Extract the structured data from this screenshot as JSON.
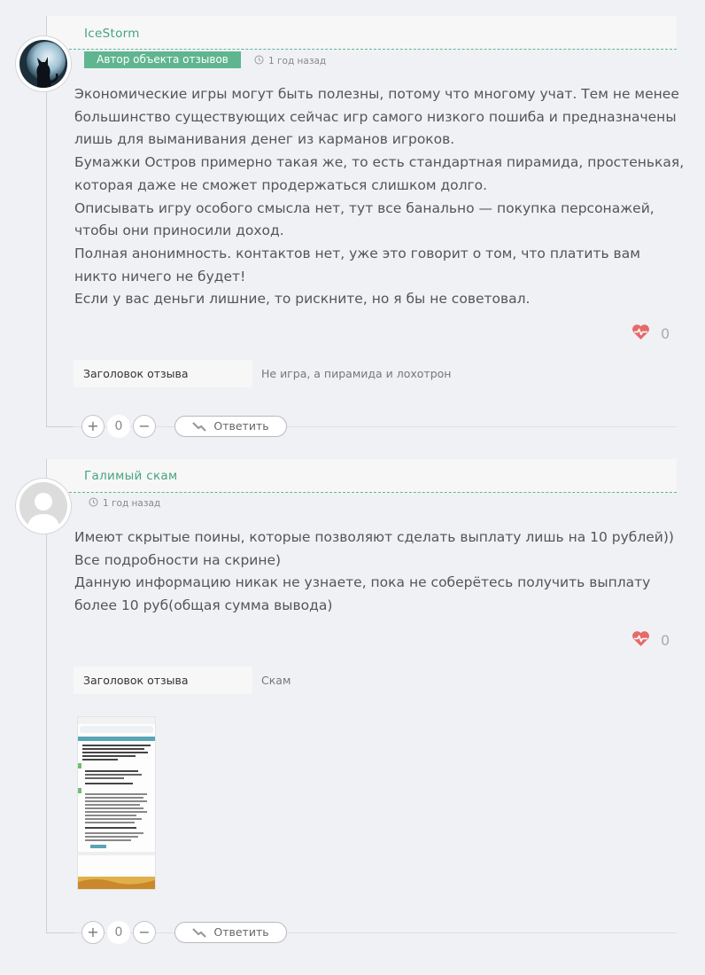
{
  "comments": [
    {
      "author": "IceStorm",
      "badge": "Автор объекта отзывов",
      "time": "1 год назад",
      "paragraphs": [
        "Экономические игры могут быть полезны, потому что многому учат. Тем не менее большинство существующих сейчас игр самого низкого пошиба и предназначены лишь для выманивания денег из карманов игроков.",
        "Бумажки Остров примерно такая же, то есть стандартная пирамида, простенькая, которая даже не сможет продержаться слишком долго.",
        "Описывать игру особого смысла нет, тут все банально — покупка персонажей, чтобы они приносили доход.",
        "Полная анонимность. контактов нет, уже это говорит о том, что платить вам никто ничего не будет!",
        "Если у вас деньги лишние, то рискните, но я бы не советовал."
      ],
      "likes": "0",
      "review_title_label": "Заголовок отзыва",
      "review_title_value": "Не игра, а пирамида и лохотрон",
      "vote_plus": "+",
      "vote_count": "0",
      "vote_minus": "−",
      "reply_label": "Ответить"
    },
    {
      "author": "Галимый скам",
      "time": "1 год назад",
      "paragraphs": [
        "Имеют скрытые поины, которые позволяют сделать выплату лишь на 10 рублей))",
        "Все подробности на скрине)",
        "Данную информацию никак не узнаете, пока не соберётесь получить выплату более 10 руб(общая сумма вывода)"
      ],
      "likes": "0",
      "review_title_label": "Заголовок отзыва",
      "review_title_value": "Скам",
      "vote_plus": "+",
      "vote_count": "0",
      "vote_minus": "−",
      "reply_label": "Ответить"
    }
  ],
  "colors": {
    "accent": "#5fb58f",
    "author": "#45a37e",
    "heart": "#e66a6a",
    "background": "#f0f1f5"
  },
  "icons": [
    "clock-icon",
    "heart-pulse-icon",
    "reply-arrow-icon",
    "default-avatar-icon",
    "cat-moon-avatar"
  ]
}
